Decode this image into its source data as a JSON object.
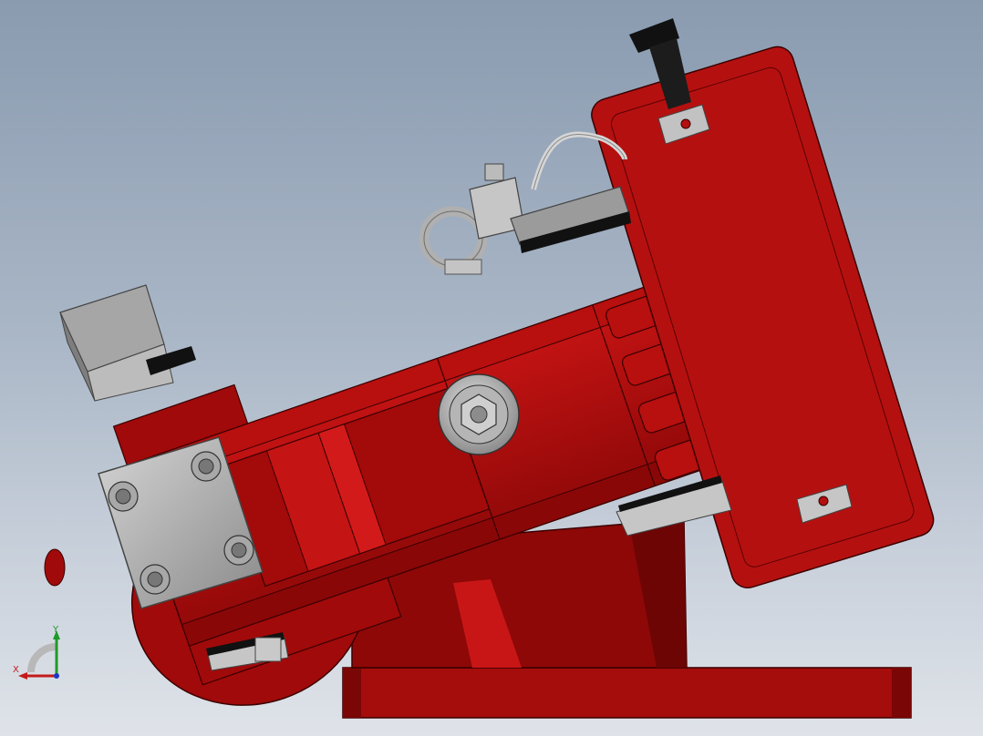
{
  "scene": {
    "subject": "red-brake-assembly",
    "colors": {
      "background_top": "#8a9bb0",
      "background_bottom": "#dfe3e9",
      "red_main": "#b30f0f",
      "red_dark": "#7a0606",
      "red_light": "#d31a1a",
      "steel": "#b9b9b9",
      "steel_dark": "#7e7e7e",
      "black": "#111111"
    }
  },
  "triad": {
    "x_label": "X",
    "y_label": "Y",
    "x_color": "#c41a1a",
    "y_color": "#1e9a2a",
    "z_color": "#1a36c4"
  }
}
